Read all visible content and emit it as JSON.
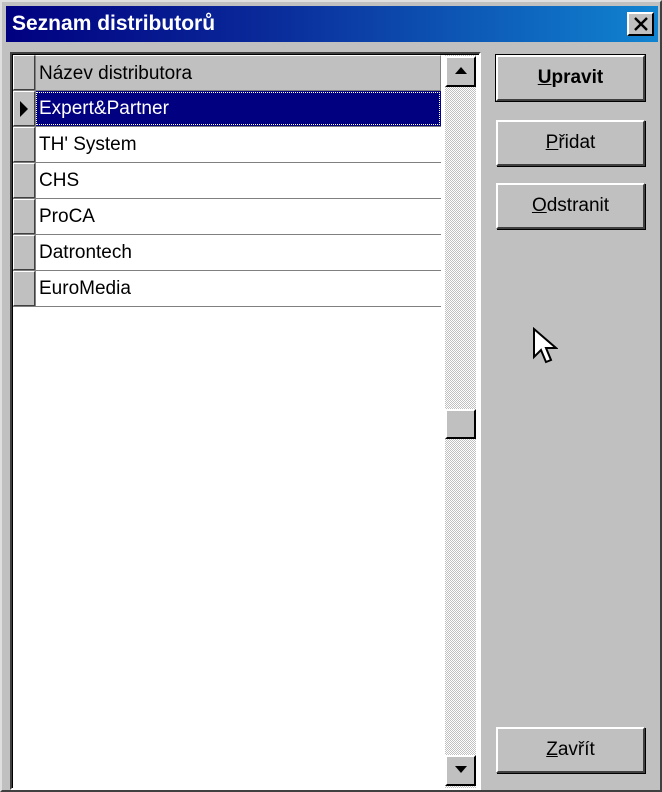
{
  "window": {
    "title": "Seznam distributorů"
  },
  "grid": {
    "column_header": "Název distributora",
    "rows": [
      {
        "name": "Expert&Partner",
        "selected": true
      },
      {
        "name": "TH' System",
        "selected": false
      },
      {
        "name": "CHS",
        "selected": false
      },
      {
        "name": "ProCA",
        "selected": false
      },
      {
        "name": "Datrontech",
        "selected": false
      },
      {
        "name": "EuroMedia",
        "selected": false
      }
    ]
  },
  "buttons": {
    "upravit": {
      "accel": "U",
      "rest": "pravit"
    },
    "pridat": {
      "accel": "P",
      "rest": "řidat"
    },
    "odstranit": {
      "accel": "O",
      "rest": "dstranit"
    },
    "zavrit": {
      "accel": "Z",
      "rest": "avřít"
    }
  },
  "icons": {
    "close": "close-icon",
    "scroll_up": "arrow-up-icon",
    "scroll_down": "arrow-down-icon",
    "row_pointer": "row-pointer-icon",
    "cursor": "mouse-pointer-icon"
  },
  "colors": {
    "title_bar_start": "#000080",
    "title_bar_end": "#1084d0",
    "selection": "#000080",
    "face": "#c0c0c0"
  }
}
